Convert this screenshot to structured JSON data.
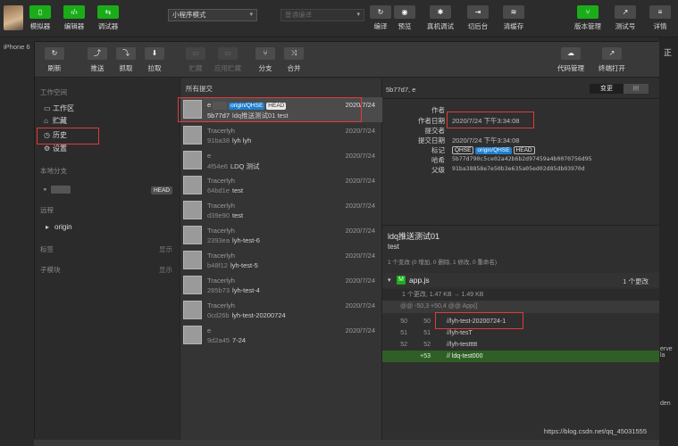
{
  "topbar": {
    "buttons_left": [
      {
        "label": "模拟器",
        "icon": "phone-icon"
      },
      {
        "label": "编辑器",
        "icon": "code-icon"
      },
      {
        "label": "调试器",
        "icon": "debug-arrows-icon"
      }
    ],
    "mode_select": "小程序模式",
    "compile_select": "普通编译",
    "buttons_mid": [
      {
        "label": "编译",
        "icon": "refresh-icon"
      },
      {
        "label": "预览",
        "icon": "eye-icon"
      },
      {
        "label": "真机调试",
        "icon": "bug-icon"
      },
      {
        "label": "切后台",
        "icon": "switch-icon"
      },
      {
        "label": "清缓存",
        "icon": "layers-icon"
      }
    ],
    "buttons_right": [
      {
        "label": "版本管理",
        "icon": "branch-icon"
      },
      {
        "label": "测试号",
        "icon": "external-icon"
      },
      {
        "label": "详情",
        "icon": "menu-icon"
      }
    ]
  },
  "background": {
    "device_label": "iPhone 6",
    "right_label": "正",
    "right_snippets": [
      "erve la",
      "den"
    ]
  },
  "dialog_toolbar": {
    "left": [
      {
        "label": "刷新",
        "icon": "refresh-icon",
        "enabled": true
      },
      {
        "label": "推送",
        "icon": "push-icon",
        "enabled": true
      },
      {
        "label": "抓取",
        "icon": "fetch-icon",
        "enabled": true
      },
      {
        "label": "拉取",
        "icon": "pull-icon",
        "enabled": true
      },
      {
        "label": "贮藏",
        "icon": "stash-icon",
        "enabled": false
      },
      {
        "label": "应用贮藏",
        "icon": "apply-stash-icon",
        "enabled": false
      },
      {
        "label": "分支",
        "icon": "branch-icon",
        "enabled": true
      },
      {
        "label": "合并",
        "icon": "merge-icon",
        "enabled": true
      }
    ],
    "right": [
      {
        "label": "代码管理",
        "icon": "cloud-icon"
      },
      {
        "label": "终端打开",
        "icon": "terminal-icon"
      }
    ]
  },
  "leftnav": {
    "workspace_title": "工作空间",
    "workspace_items": [
      {
        "label": "工作区",
        "icon": "folder-icon"
      },
      {
        "label": "贮藏",
        "icon": "archive-icon"
      },
      {
        "label": "历史",
        "icon": "history-icon"
      },
      {
        "label": "设置",
        "icon": "gear-icon"
      }
    ],
    "local_branch_title": "本地分支",
    "local_branch_badge": "HEAD",
    "remote_title": "远程",
    "remote_item": "origin",
    "tags_title": "标签",
    "tags_action": "显示",
    "submodule_title": "子模块",
    "submodule_action": "显示"
  },
  "commits": {
    "header": "所有提交",
    "items": [
      {
        "author": "e",
        "tags": [
          "origin/QHSE",
          "HEAD"
        ],
        "date": "2020/7/24",
        "hash": "5b77d7",
        "message": "ldq推送测试01 test"
      },
      {
        "author": "Tracerlyh",
        "date": "2020/7/24",
        "hash": "91ba38",
        "message": "lyh lyh"
      },
      {
        "author": "e",
        "date": "2020/7/24",
        "hash": "4f54e6",
        "message": "LDQ 测试"
      },
      {
        "author": "Tracerlyh",
        "date": "2020/7/24",
        "hash": "64bd1e",
        "message": "test"
      },
      {
        "author": "Tracerlyh",
        "date": "2020/7/24",
        "hash": "d39e90",
        "message": "test"
      },
      {
        "author": "Tracerlyh",
        "date": "2020/7/24",
        "hash": "2393ea",
        "message": "lyh-test-6"
      },
      {
        "author": "Tracerlyh",
        "date": "2020/7/24",
        "hash": "b48f12",
        "message": "lyh-test-5"
      },
      {
        "author": "Tracerlyh",
        "date": "2020/7/24",
        "hash": "285b73",
        "message": "lyh-test-4"
      },
      {
        "author": "Tracerlyh",
        "date": "2020/7/24",
        "hash": "0cd26b",
        "message": "lyh-test-20200724"
      },
      {
        "author": "e",
        "date": "2020/7/24",
        "hash": "9d2a45",
        "message": "7-24"
      }
    ]
  },
  "detail": {
    "top_label": "5b77d7, e",
    "seg_on": "变更",
    "seg_off": "树",
    "meta": [
      {
        "key": "作者",
        "value": ""
      },
      {
        "key": "作者日期",
        "value": "2020/7/24 下午3:34:08"
      },
      {
        "key": "提交者",
        "value": ""
      },
      {
        "key": "提交日期",
        "value": "2020/7/24 下午3:34:08"
      },
      {
        "key": "标记",
        "value": ""
      },
      {
        "key": "哈希",
        "value": "5b77d790c5ce02a42b6b2d97459a4b0070756d95"
      },
      {
        "key": "父级",
        "value": "91ba38858e7e50b3e635a05ed02d85db03970d"
      }
    ],
    "tag_labels": [
      "QHSE",
      "origin/QHSE",
      "HEAD"
    ],
    "commit_title": "ldq推送测试01",
    "commit_body": "test",
    "commit_stat": "1 个变改 (0 增加, 0 删除, 1 修改, 0 重命名)",
    "file": {
      "status": "M",
      "name": "app.js",
      "changes": "1 个更改"
    },
    "size_row": "1 个更改, 1.47 KB  →  1.49 KB",
    "hunk": "@@ -50,3 +50,4 @@ App({",
    "diff": [
      {
        "old": "50",
        "new": "50",
        "code": "//lyh-test-20200724-1",
        "added": false
      },
      {
        "old": "51",
        "new": "51",
        "code": "//lyh-tesT",
        "added": false
      },
      {
        "old": "52",
        "new": "52",
        "code": "//lyh-testtttt",
        "added": false
      },
      {
        "old": "",
        "new": "+53",
        "code": "// ldq-test000",
        "added": true
      }
    ]
  },
  "watermark": "https://blog.csdn.net/qq_45031555",
  "colors": {
    "accent_green": "#1aad19",
    "annotation_red": "#e23a3a",
    "tag_blue": "#1e7fd0"
  }
}
